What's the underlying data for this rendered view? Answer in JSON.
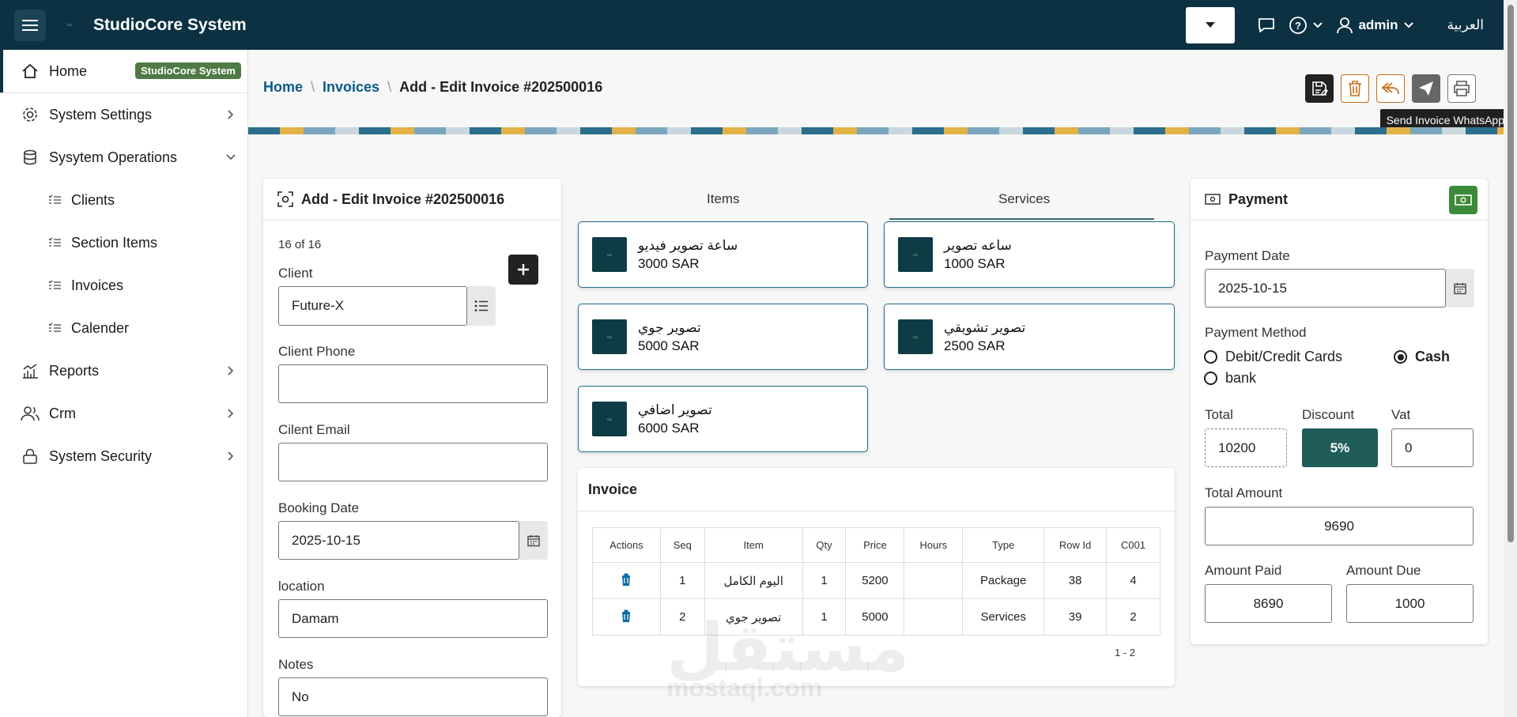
{
  "topbar": {
    "title": "StudioCore System",
    "user": "admin",
    "language": "العربية"
  },
  "sidebar": {
    "home": {
      "label": "Home",
      "badge": "StudioCore System"
    },
    "items": [
      {
        "label": "System Settings"
      },
      {
        "label": "Sysytem Operations"
      },
      {
        "label": "Clients"
      },
      {
        "label": "Section Items"
      },
      {
        "label": "Invoices"
      },
      {
        "label": "Calender"
      },
      {
        "label": "Reports"
      },
      {
        "label": "Crm"
      },
      {
        "label": "System Security"
      }
    ]
  },
  "breadcrumb": {
    "home": "Home",
    "invoices": "Invoices",
    "current": "Add - Edit Invoice #202500016"
  },
  "tooltip": "Send Invoice WhatsApp",
  "invoice_form": {
    "title": "Add - Edit Invoice #202500016",
    "counter": "16 of 16",
    "client_label": "Client",
    "client_value": "Future-X",
    "phone_label": "Client Phone",
    "phone_value": "",
    "email_label": "Cilent Email",
    "email_value": "",
    "booking_label": "Booking Date",
    "booking_value": "2025-10-15",
    "location_label": "location",
    "location_value": "Damam",
    "notes_label": "Notes",
    "notes_value": "No"
  },
  "tabs": {
    "items": "Items",
    "services": "Services"
  },
  "tiles": [
    {
      "name": "ساعة تصوير فيديو",
      "price": "3000 SAR"
    },
    {
      "name": "ساعه تصوير",
      "price": "1000 SAR"
    },
    {
      "name": "تصوير جوي",
      "price": "5000 SAR"
    },
    {
      "name": "تصوير تشويقي",
      "price": "2500 SAR"
    },
    {
      "name": "تصوير اضافي",
      "price": "6000 SAR"
    }
  ],
  "invoice_table": {
    "title": "Invoice",
    "headers": [
      "Actions",
      "Seq",
      "Item",
      "Qty",
      "Price",
      "Hours",
      "Type",
      "Row Id",
      "C001"
    ],
    "rows": [
      {
        "seq": "1",
        "item": "اليوم الكامل",
        "qty": "1",
        "price": "5200",
        "hours": "",
        "type": "Package",
        "row_id": "38",
        "c001": "4"
      },
      {
        "seq": "2",
        "item": "تصوير جوي",
        "qty": "1",
        "price": "5000",
        "hours": "",
        "type": "Services",
        "row_id": "39",
        "c001": "2"
      }
    ],
    "pagination": "1 - 2"
  },
  "payment": {
    "title": "Payment",
    "date_label": "Payment Date",
    "date_value": "2025-10-15",
    "method_label": "Payment Method",
    "methods": {
      "card": "Debit/Credit Cards",
      "cash": "Cash",
      "bank": "bank"
    },
    "selected_method": "Cash",
    "total_label": "Total",
    "total_value": "10200",
    "discount_label": "Discount",
    "discount_value": "5%",
    "vat_label": "Vat",
    "vat_value": "0",
    "total_amount_label": "Total Amount",
    "total_amount_value": "9690",
    "paid_label": "Amount Paid",
    "paid_value": "8690",
    "due_label": "Amount Due",
    "due_value": "1000"
  },
  "watermark": {
    "main": "مستقل",
    "sub": "mostaql.com"
  },
  "colors": {
    "topbar": "#0b3142",
    "badge": "#4e7a45",
    "discount": "#1f5c5a",
    "link": "#0a5a86",
    "tile_border": "#1e6a8c"
  }
}
